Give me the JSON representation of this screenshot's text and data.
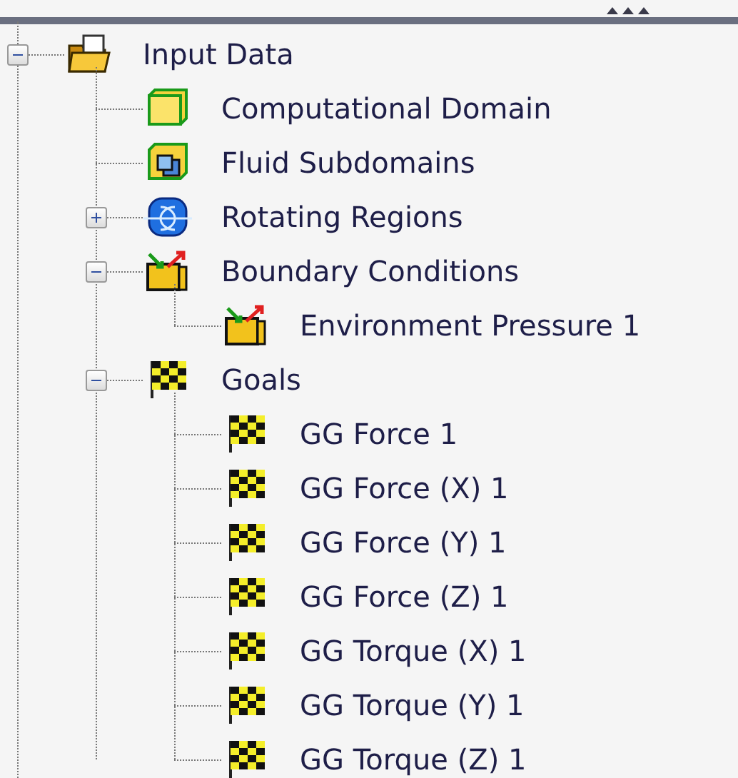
{
  "tree": [
    {
      "label": "Input Data",
      "kind": "folder",
      "expanded": true,
      "children": [
        {
          "label": "Computational Domain",
          "kind": "domain"
        },
        {
          "label": "Fluid Subdomains",
          "kind": "subdomain"
        },
        {
          "label": "Rotating Regions",
          "kind": "rotating",
          "expanded": false
        },
        {
          "label": "Boundary Conditions",
          "kind": "boundary",
          "expanded": true,
          "children": [
            {
              "label": "Environment Pressure 1",
              "kind": "boundary"
            }
          ]
        },
        {
          "label": "Goals",
          "kind": "goal",
          "expanded": true,
          "children": [
            {
              "label": "GG Force 1",
              "kind": "goal"
            },
            {
              "label": "GG Force (X) 1",
              "kind": "goal"
            },
            {
              "label": "GG Force (Y) 1",
              "kind": "goal"
            },
            {
              "label": "GG Force (Z) 1",
              "kind": "goal"
            },
            {
              "label": "GG Torque (X) 1",
              "kind": "goal"
            },
            {
              "label": "GG Torque (Y) 1",
              "kind": "goal"
            },
            {
              "label": "GG Torque (Z) 1",
              "kind": "goal"
            }
          ]
        }
      ]
    }
  ]
}
